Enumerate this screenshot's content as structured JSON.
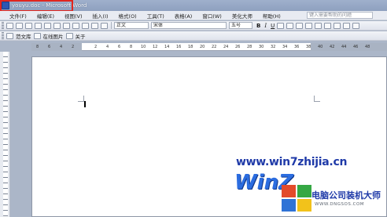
{
  "window": {
    "title": "youyu.doc - Microsoft Word",
    "highlight_color": "#e0261f"
  },
  "menu": {
    "items": [
      "文件(F)",
      "编辑(E)",
      "视图(V)",
      "插入(I)",
      "格式(O)",
      "工具(T)",
      "表格(A)",
      "窗口(W)",
      "美化大师",
      "帮助(H)"
    ],
    "help_placeholder": "键入需要帮助的问题"
  },
  "toolbar": {
    "style": "正文",
    "font": "宋体",
    "size": "五号",
    "bold": "B",
    "italic": "I",
    "underline": "U"
  },
  "toolbar2": {
    "item1": "范文库",
    "item2": "在线图片",
    "item3": "关于"
  },
  "ruler": {
    "ticks": [
      "8",
      "6",
      "4",
      "2",
      "2",
      "4",
      "6",
      "8",
      "10",
      "12",
      "14",
      "16",
      "18",
      "20",
      "22",
      "24",
      "26",
      "28",
      "30",
      "32",
      "34",
      "36",
      "38",
      "40",
      "42",
      "44",
      "46",
      "48"
    ]
  },
  "watermark": {
    "url": "www.win7zhijia.cn",
    "logo": "WinZ",
    "brand": "电脑公司装机大师",
    "site": "WWW.DNGSOS.COM"
  }
}
